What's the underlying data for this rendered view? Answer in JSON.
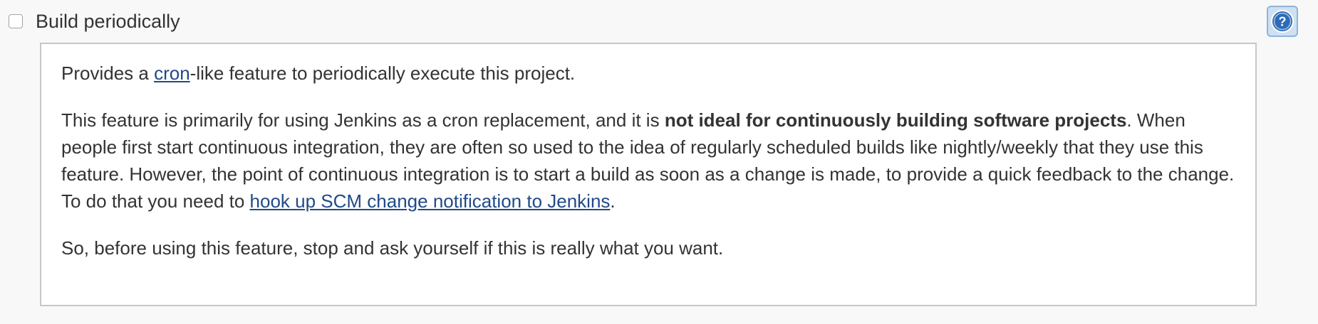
{
  "option": {
    "label": "Build periodically",
    "checked": false
  },
  "help_button": {
    "icon": "question-circle-icon",
    "accent_color": "#2c6bb8"
  },
  "help": {
    "p1_before": "Provides a ",
    "p1_link": "cron",
    "p1_after": "-like feature to periodically execute this project.",
    "p2_before": "This feature is primarily for using Jenkins as a cron replacement, and it is ",
    "p2_bold": "not ideal for continuously building software projects",
    "p2_middle": ". When people first start continuous integration, they are often so used to the idea of regularly scheduled builds like nightly/weekly that they use this feature. However, the point of continuous integration is to start a build as soon as a change is made, to provide a quick feedback to the change. To do that you need to ",
    "p2_link": "hook up SCM change notification to Jenkins",
    "p2_after": ".",
    "p3": "So, before using this feature, stop and ask yourself if this is really what you want."
  },
  "colors": {
    "link": "#204a87",
    "text": "#333333",
    "page_background": "#f8f8f8",
    "panel_border": "#c7c7c7"
  }
}
